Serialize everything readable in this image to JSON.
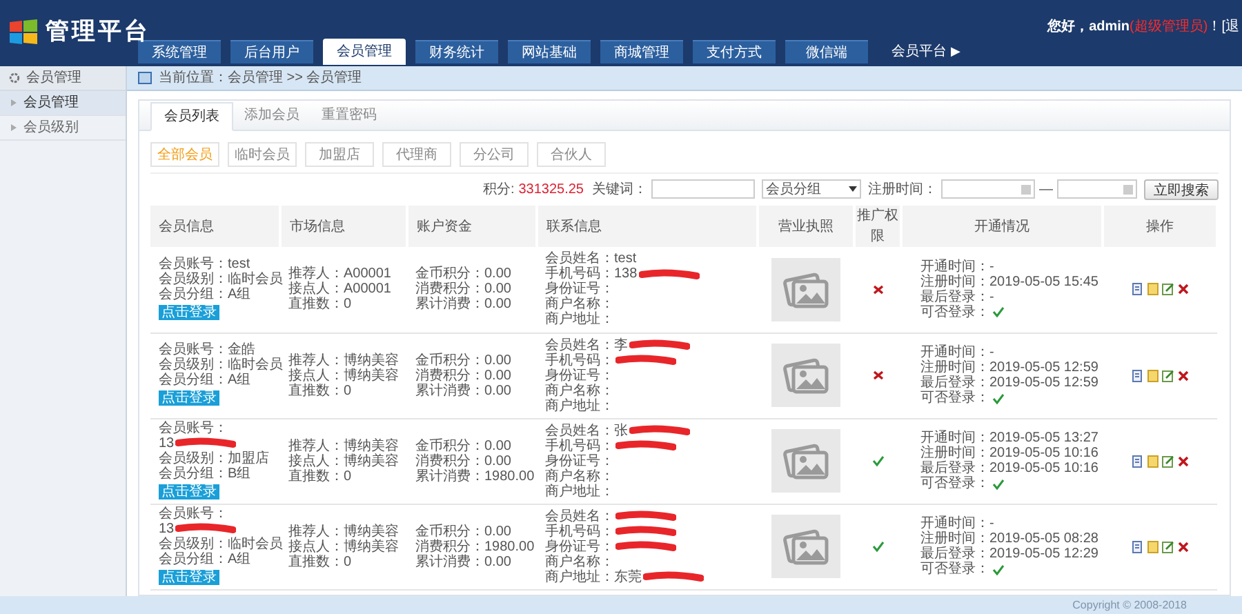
{
  "brand": "管理平台",
  "nav": [
    {
      "label": "系统管理",
      "selected": false
    },
    {
      "label": "后台用户",
      "selected": false
    },
    {
      "label": "会员管理",
      "selected": true
    },
    {
      "label": "财务统计",
      "selected": false
    },
    {
      "label": "网站基础",
      "selected": false
    },
    {
      "label": "商城管理",
      "selected": false
    },
    {
      "label": "支付方式",
      "selected": false
    },
    {
      "label": "微信端",
      "selected": false
    }
  ],
  "nav_link": {
    "label": "会员平台",
    "arrow": "▶"
  },
  "user": {
    "greeting": "您好，admin",
    "role": "(超级管理员)",
    "logout": "！[退"
  },
  "sidebar": {
    "title": "会员管理",
    "items": [
      {
        "label": "会员管理",
        "selected": true
      },
      {
        "label": "会员级别",
        "selected": false
      }
    ]
  },
  "breadcrumb": "当前位置：会员管理 >> 会员管理",
  "tabs": [
    {
      "label": "会员列表",
      "selected": true
    },
    {
      "label": "添加会员",
      "selected": false
    },
    {
      "label": "重置密码",
      "selected": false
    }
  ],
  "filters": [
    {
      "label": "全部会员",
      "selected": true
    },
    {
      "label": "临时会员",
      "selected": false
    },
    {
      "label": "加盟店",
      "selected": false
    },
    {
      "label": "代理商",
      "selected": false
    },
    {
      "label": "分公司",
      "selected": false
    },
    {
      "label": "合伙人",
      "selected": false
    }
  ],
  "search": {
    "points_label": "积分:",
    "points": "331325.25",
    "keyword_label": "关键词：",
    "group_select": "会员分组",
    "date_label": "注册时间：",
    "dash": "—",
    "button": "立即搜索"
  },
  "table": {
    "columns": [
      "会员信息",
      "市场信息",
      "账户资金",
      "联系信息",
      "营业执照",
      "推广权限",
      "开通情况",
      "操作"
    ],
    "rows": [
      {
        "member": [
          {
            "text": "会员账号：test",
            "redacted": false
          },
          {
            "text": "会员级别：临时会员",
            "redacted": false
          },
          {
            "text": "会员分组：A组",
            "redacted": false
          }
        ],
        "login": "点击登录",
        "market": [
          "推荐人：A00001",
          "接点人：A00001",
          "直推数：0"
        ],
        "funds": [
          "金币积分：0.00",
          "消费积分：0.00",
          "累计消费：0.00"
        ],
        "contact": [
          {
            "text": "会员姓名：test",
            "redacted": false
          },
          {
            "text": "手机号码：138",
            "redacted": true
          },
          {
            "text": "身份证号：",
            "redacted": false
          },
          {
            "text": "商户名称：",
            "redacted": false
          },
          {
            "text": "商户地址：",
            "redacted": false
          }
        ],
        "promotion": false,
        "status": [
          "开通时间：-",
          "注册时间：2019-05-05 15:45",
          "最后登录：-"
        ],
        "can_login_label": "可否登录：",
        "can_login": true
      },
      {
        "member": [
          {
            "text": "会员账号：金皓",
            "redacted": false
          },
          {
            "text": "会员级别：临时会员",
            "redacted": false
          },
          {
            "text": "会员分组：A组",
            "redacted": false
          }
        ],
        "login": "点击登录",
        "market": [
          "推荐人：博纳美容",
          "接点人：博纳美容",
          "直推数：0"
        ],
        "funds": [
          "金币积分：0.00",
          "消费积分：0.00",
          "累计消费：0.00"
        ],
        "contact": [
          {
            "text": "会员姓名：李",
            "redacted": true
          },
          {
            "text": "手机号码：",
            "redacted": true
          },
          {
            "text": "身份证号：",
            "redacted": false
          },
          {
            "text": "商户名称：",
            "redacted": false
          },
          {
            "text": "商户地址：",
            "redacted": false
          }
        ],
        "promotion": false,
        "status": [
          "开通时间：-",
          "注册时间：2019-05-05 12:59",
          "最后登录：2019-05-05 12:59"
        ],
        "can_login_label": "可否登录：",
        "can_login": true
      },
      {
        "member": [
          {
            "text": "会员账号：",
            "redacted": false
          },
          {
            "text": "13",
            "redacted": true
          },
          {
            "text": "会员级别：加盟店",
            "redacted": false
          },
          {
            "text": "会员分组：B组",
            "redacted": false
          }
        ],
        "login": "点击登录",
        "market": [
          "推荐人：博纳美容",
          "接点人：博纳美容",
          "直推数：0"
        ],
        "funds": [
          "金币积分：0.00",
          "消费积分：0.00",
          "累计消费：1980.00"
        ],
        "contact": [
          {
            "text": "会员姓名：张",
            "redacted": true
          },
          {
            "text": "手机号码：",
            "redacted": true
          },
          {
            "text": "身份证号：",
            "redacted": false
          },
          {
            "text": "商户名称：",
            "redacted": false
          },
          {
            "text": "商户地址：",
            "redacted": false
          }
        ],
        "promotion": true,
        "status": [
          "开通时间：2019-05-05 13:27",
          "注册时间：2019-05-05 10:16",
          "最后登录：2019-05-05 10:16"
        ],
        "can_login_label": "可否登录：",
        "can_login": true
      },
      {
        "member": [
          {
            "text": "会员账号：",
            "redacted": false
          },
          {
            "text": "13",
            "redacted": true
          },
          {
            "text": "会员级别：临时会员",
            "redacted": false
          },
          {
            "text": "会员分组：A组",
            "redacted": false
          }
        ],
        "login": "点击登录",
        "market": [
          "推荐人：博纳美容",
          "接点人：博纳美容",
          "直推数：0"
        ],
        "funds": [
          "金币积分：0.00",
          "消费积分：1980.00",
          "累计消费：0.00"
        ],
        "contact": [
          {
            "text": "会员姓名：",
            "redacted": true
          },
          {
            "text": "手机号码：",
            "redacted": true
          },
          {
            "text": "身份证号：",
            "redacted": true
          },
          {
            "text": "商户名称：",
            "redacted": false
          },
          {
            "text": "商户地址：东莞",
            "redacted": true
          }
        ],
        "promotion": true,
        "status": [
          "开通时间：-",
          "注册时间：2019-05-05 08:28",
          "最后登录：2019-05-05 12:29"
        ],
        "can_login_label": "可否登录：",
        "can_login": true
      }
    ]
  },
  "footer": "Copyright © 2008-2018"
}
